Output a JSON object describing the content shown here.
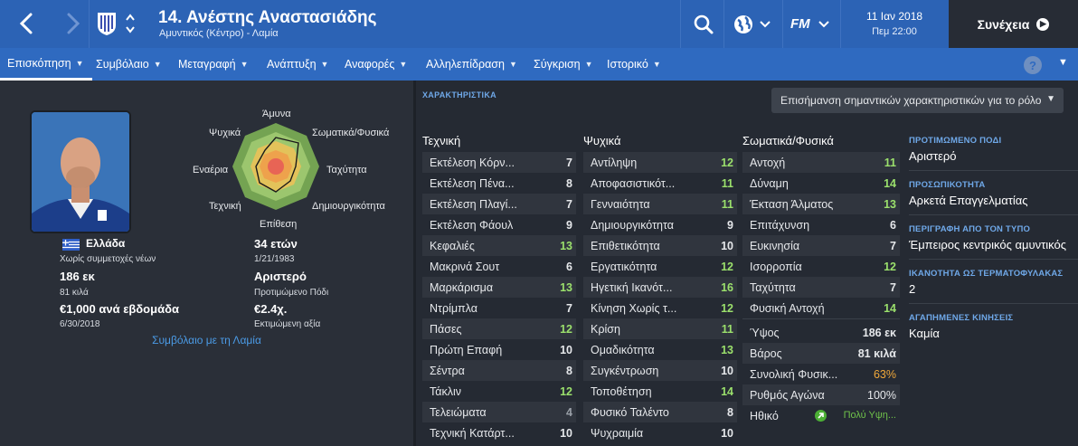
{
  "header": {
    "player_name": "14. Ανέστης Αναστασιάδης",
    "player_sub": "Αμυντικός (Κέντρο) - Λαμία",
    "date": "11 Ιαν 2018",
    "time": "Πεμ 22:00",
    "continue_label": "Συνέχεια",
    "fm_label": "FM",
    "icons": [
      "back-arrow-icon",
      "forward-arrow-icon",
      "club-crest-icon",
      "up-down-icon",
      "search-icon",
      "globe-icon",
      "fm-logo-icon",
      "arrow-circle-icon"
    ]
  },
  "nav": {
    "items": [
      "Επισκόπηση",
      "Συμβόλαιο",
      "Μεταγραφή",
      "Ανάπτυξη",
      "Αναφορές",
      "Αλληλεπίδραση",
      "Σύγκριση",
      "Ιστορικό"
    ],
    "help": "?"
  },
  "profile": {
    "nationality": "Ελλάδα",
    "youth_apps": "Χωρίς συμμετοχές νέων",
    "height": "186 εκ",
    "weight": "81 κιλά",
    "wage": "€1,000 ανά εβδομάδα",
    "contract_end": "6/30/2018",
    "age": "34 ετών",
    "dob": "1/21/1983",
    "foot": "Αριστερό",
    "foot_label": "Προτιμώμενο Πόδι",
    "value": "€2.4χ.",
    "value_label": "Εκτιμώμενη αξία",
    "contract_link": "Συμβόλαιο με τη Λαμία"
  },
  "radar": {
    "labels": {
      "top": "Άμυνα",
      "top_right": "Σωματικά/Φυσικά",
      "right": "Ταχύτητα",
      "bottom_right": "Δημιουργικότητα",
      "bottom": "Επίθεση",
      "bottom_left": "Τεχνική",
      "left": "Εναέρια",
      "top_left": "Ψυχικά"
    }
  },
  "attributes": {
    "heading": "ΧΑΡΑΚΤΗΡΙΣΤΙΚΑ",
    "highlight_label": "Επισήμανση σημαντικών χαρακτηριστικών για το ρόλο",
    "technical_title": "Τεχνική",
    "mental_title": "Ψυχικά",
    "physical_title": "Σωματικά/Φυσικά",
    "technical": [
      {
        "name": "Εκτέλεση Κόρν...",
        "value": "7"
      },
      {
        "name": "Εκτέλεση Πένα...",
        "value": "8"
      },
      {
        "name": "Εκτέλεση Πλαγί...",
        "value": "7"
      },
      {
        "name": "Εκτέλεση Φάουλ",
        "value": "9"
      },
      {
        "name": "Κεφαλιές",
        "value": "13"
      },
      {
        "name": "Μακρινά Σουτ",
        "value": "6"
      },
      {
        "name": "Μαρκάρισμα",
        "value": "13"
      },
      {
        "name": "Ντρίμπλα",
        "value": "7"
      },
      {
        "name": "Πάσες",
        "value": "12"
      },
      {
        "name": "Πρώτη Επαφή",
        "value": "10"
      },
      {
        "name": "Σέντρα",
        "value": "8"
      },
      {
        "name": "Τάκλιν",
        "value": "12"
      },
      {
        "name": "Τελειώματα",
        "value": "4"
      },
      {
        "name": "Τεχνική Κατάρτ...",
        "value": "10"
      }
    ],
    "mental": [
      {
        "name": "Αντίληψη",
        "value": "12"
      },
      {
        "name": "Αποφασιστικότ...",
        "value": "11"
      },
      {
        "name": "Γενναιότητα",
        "value": "11"
      },
      {
        "name": "Δημιουργικότητα",
        "value": "9"
      },
      {
        "name": "Επιθετικότητα",
        "value": "10"
      },
      {
        "name": "Εργατικότητα",
        "value": "12"
      },
      {
        "name": "Ηγετική Ικανότ...",
        "value": "16"
      },
      {
        "name": "Κίνηση Χωρίς τ...",
        "value": "12"
      },
      {
        "name": "Κρίση",
        "value": "11"
      },
      {
        "name": "Ομαδικότητα",
        "value": "13"
      },
      {
        "name": "Συγκέντρωση",
        "value": "10"
      },
      {
        "name": "Τοποθέτηση",
        "value": "14"
      },
      {
        "name": "Φυσικό Ταλέντο",
        "value": "8"
      },
      {
        "name": "Ψυχραιμία",
        "value": "10"
      }
    ],
    "physical": [
      {
        "name": "Αντοχή",
        "value": "11"
      },
      {
        "name": "Δύναμη",
        "value": "14"
      },
      {
        "name": "Έκταση Άλματος",
        "value": "13"
      },
      {
        "name": "Επιτάχυνση",
        "value": "6"
      },
      {
        "name": "Ευκινησία",
        "value": "7"
      },
      {
        "name": "Ισορροπία",
        "value": "12"
      },
      {
        "name": "Ταχύτητα",
        "value": "7"
      },
      {
        "name": "Φυσική Αντοχή",
        "value": "14"
      }
    ],
    "extra": [
      {
        "name": "Ύψος",
        "value": "186 εκ"
      },
      {
        "name": "Βάρος",
        "value": "81 κιλά"
      },
      {
        "name": "Συνολική Φυσικ...",
        "value": "63%"
      },
      {
        "name": "Ρυθμός Αγώνα",
        "value": "100%"
      },
      {
        "name": "Ηθικό",
        "value": "Πολύ Υψη..."
      }
    ]
  },
  "info": {
    "foot_title": "ΠΡΟΤΙΜΩΜΕΝΟ ΠΟΔΙ",
    "foot_value": "Αριστερό",
    "personality_title": "ΠΡΟΣΩΠΙΚΟΤΗΤΑ",
    "personality_value": "Αρκετά Επαγγελματίας",
    "media_title": "ΠΕΡΙΓΡΑΦΗ ΑΠΟ ΤΟΝ ΤΥΠΟ",
    "media_value": "Έμπειρος κεντρικός αμυντικός",
    "gk_title": "ΙΚΑΝΟΤΗΤΑ ΩΣ ΤΕΡΜΑΤΟΦΥΛΑΚΑΣ",
    "gk_value": "2",
    "moves_title": "ΑΓΑΠΗΜΕΝΕΣ ΚΙΝΗΣΕΙΣ",
    "moves_value": "Καμία"
  },
  "colors": {
    "header_blue": "#2c63b5",
    "nav_blue": "#2f6ac0",
    "high_value_green": "#9be06c",
    "condition_orange": "#f0a83a",
    "link_blue": "#4b9be6"
  }
}
